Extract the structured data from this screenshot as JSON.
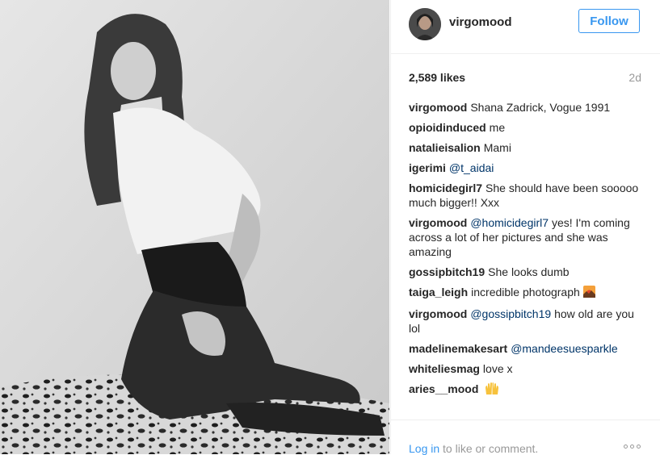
{
  "post": {
    "username": "virgomood",
    "follow_label": "Follow",
    "likes": "2,589 likes",
    "time": "2d",
    "caption_user": "virgomood",
    "caption_text": "Shana Zadrick, Vogue 1991"
  },
  "comments": [
    {
      "user": "opioidinduced",
      "text": "me"
    },
    {
      "user": "natalieisalion",
      "text": "Mami"
    },
    {
      "user": "igerimi",
      "mention": "@t_aidai"
    },
    {
      "user": "homicidegirl7",
      "text": "She should have been sooooo much bigger!! Xxx"
    },
    {
      "user": "virgomood",
      "mention": "@homicidegirl7",
      "text": "yes! I'm coming across a lot of her pictures and she was amazing"
    },
    {
      "user": "gossipbitch19",
      "text": "She looks dumb"
    },
    {
      "user": "taiga_leigh",
      "text": "incredible photograph",
      "emoji": "sunset-emoji"
    },
    {
      "user": "virgomood",
      "mention": "@gossipbitch19",
      "text": "how old are you lol"
    },
    {
      "user": "madelinemakesart",
      "mention": "@mandeesuesparkle"
    },
    {
      "user": "whiteliesmag",
      "text": "love x"
    },
    {
      "user": "aries__mood",
      "emoji": "raised-hands-emoji"
    }
  ],
  "footer": {
    "login_link": "Log in",
    "login_rest": "to like or comment."
  },
  "colors": {
    "accent": "#3897f0",
    "mention": "#003569",
    "muted": "#999999",
    "text": "#262626"
  }
}
